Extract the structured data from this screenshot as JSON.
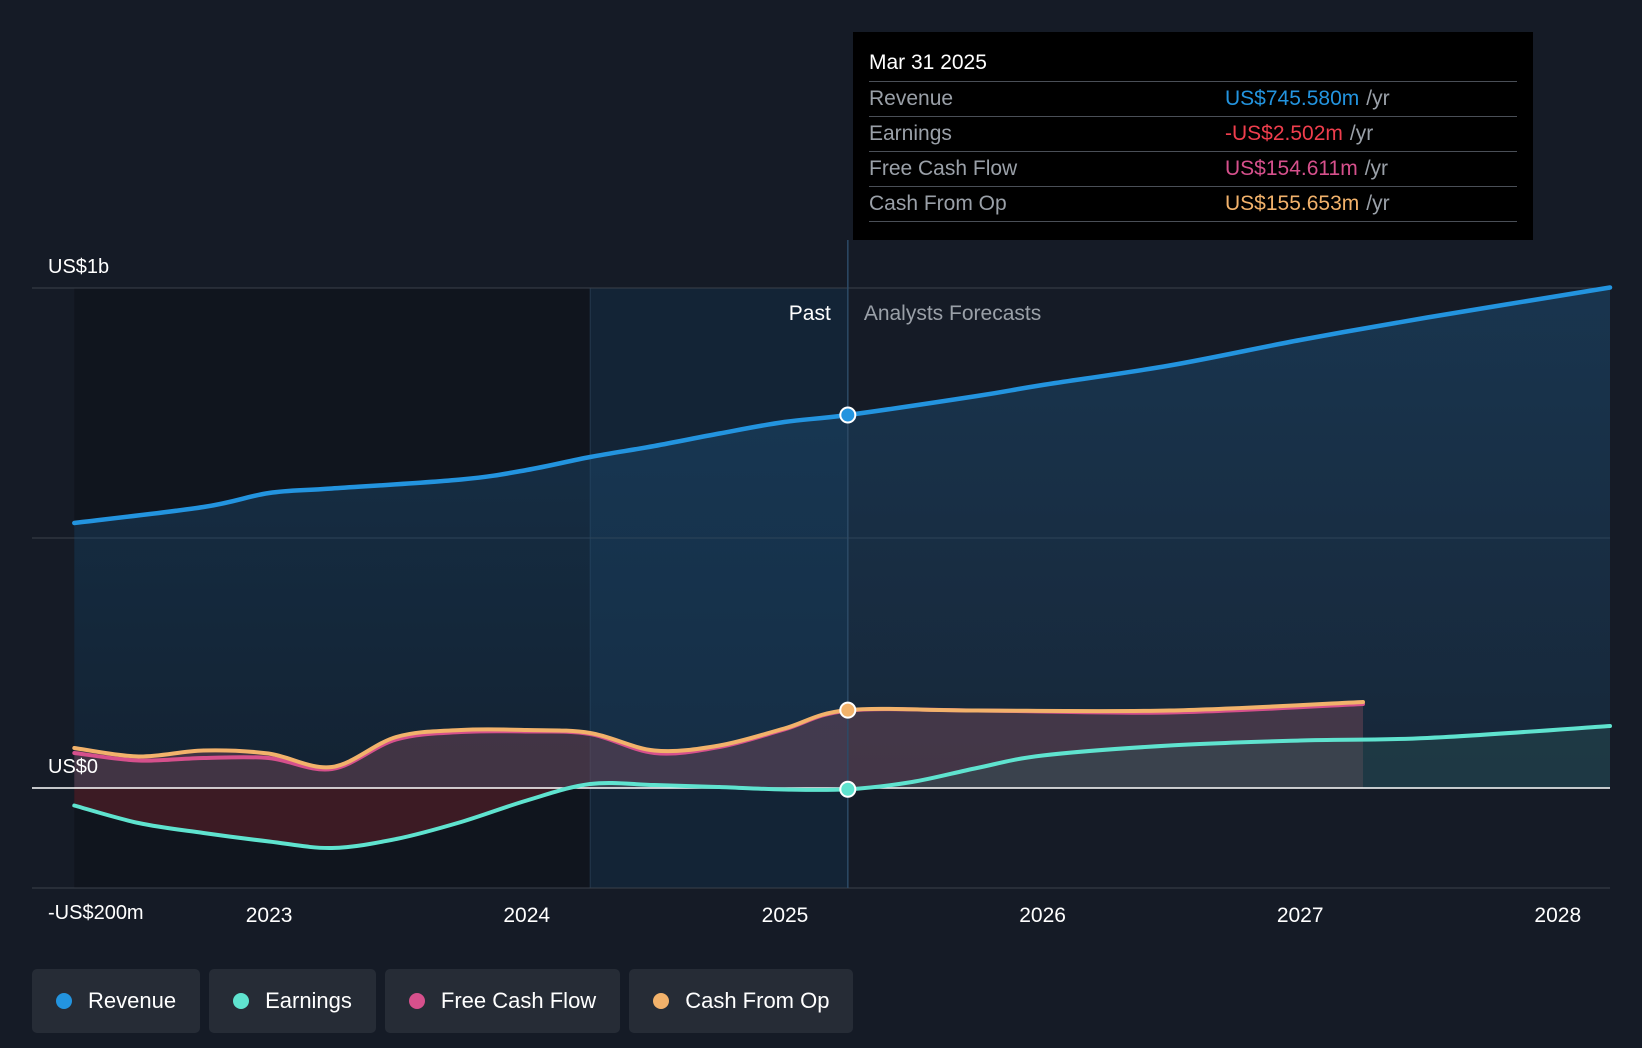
{
  "chart_data": {
    "type": "area",
    "title": "",
    "xlabel": "",
    "ylabel": "",
    "x_ticks": [
      "2023",
      "2024",
      "2025",
      "2026",
      "2027",
      "2028"
    ],
    "y_ticks": [
      {
        "value": 1000,
        "label": "US$1b"
      },
      {
        "value": 0,
        "label": "US$0"
      },
      {
        "value": -200,
        "label": "-US$200m"
      }
    ],
    "ylim": [
      -200,
      1000
    ],
    "xlim": [
      "2022-01-30",
      "2028-03-15"
    ],
    "grid": true,
    "legend_position": "bottom-left",
    "region_labels": {
      "past": "Past",
      "forecast": "Analysts Forecasts"
    },
    "highlight_start": "2024-03-31",
    "divider_date": "2025-03-31",
    "units": "US$ millions",
    "series": [
      {
        "name": "Revenue",
        "color": "#2394df",
        "points": [
          [
            "2022-03-31",
            530
          ],
          [
            "2022-09-30",
            562
          ],
          [
            "2023-01-01",
            590
          ],
          [
            "2023-03-31",
            599
          ],
          [
            "2023-09-30",
            617
          ],
          [
            "2024-01-01",
            636
          ],
          [
            "2024-03-31",
            662
          ],
          [
            "2024-06-30",
            684
          ],
          [
            "2024-09-30",
            709
          ],
          [
            "2024-12-31",
            732
          ],
          [
            "2025-03-31",
            746
          ],
          [
            "2025-09-30",
            784
          ],
          [
            "2026-01-01",
            806
          ],
          [
            "2026-06-30",
            845
          ],
          [
            "2027-01-01",
            896
          ],
          [
            "2027-06-30",
            941
          ],
          [
            "2028-03-15",
            1001
          ]
        ]
      },
      {
        "name": "Earnings",
        "color": "#5fe3cf",
        "points": [
          [
            "2022-03-31",
            -35
          ],
          [
            "2022-06-30",
            -70
          ],
          [
            "2022-09-30",
            -90
          ],
          [
            "2023-01-01",
            -107
          ],
          [
            "2023-03-31",
            -120
          ],
          [
            "2023-06-30",
            -102
          ],
          [
            "2023-09-30",
            -68
          ],
          [
            "2024-01-01",
            -25
          ],
          [
            "2024-03-31",
            8
          ],
          [
            "2024-06-30",
            6
          ],
          [
            "2024-09-30",
            2
          ],
          [
            "2024-12-31",
            -3
          ],
          [
            "2025-03-31",
            -2.5
          ],
          [
            "2025-06-30",
            12
          ],
          [
            "2025-09-30",
            40
          ],
          [
            "2026-01-01",
            65
          ],
          [
            "2026-06-30",
            85
          ],
          [
            "2027-01-01",
            95
          ],
          [
            "2027-06-30",
            100
          ],
          [
            "2028-03-15",
            124
          ]
        ]
      },
      {
        "name": "Free Cash Flow",
        "color": "#d6508c",
        "points": [
          [
            "2022-03-31",
            70
          ],
          [
            "2022-06-30",
            55
          ],
          [
            "2022-09-30",
            60
          ],
          [
            "2022-12-31",
            60
          ],
          [
            "2023-03-31",
            38
          ],
          [
            "2023-06-30",
            97
          ],
          [
            "2023-09-30",
            112
          ],
          [
            "2024-01-01",
            113
          ],
          [
            "2024-03-31",
            108
          ],
          [
            "2024-06-30",
            70
          ],
          [
            "2024-09-30",
            82
          ],
          [
            "2024-12-31",
            117
          ],
          [
            "2025-03-31",
            154.6
          ],
          [
            "2025-09-30",
            155
          ],
          [
            "2026-06-30",
            151
          ],
          [
            "2027-03-31",
            168
          ]
        ]
      },
      {
        "name": "Cash From Op",
        "color": "#f2b26b",
        "points": [
          [
            "2022-03-31",
            80
          ],
          [
            "2022-06-30",
            63
          ],
          [
            "2022-09-30",
            75
          ],
          [
            "2022-12-31",
            69
          ],
          [
            "2023-03-31",
            42
          ],
          [
            "2023-06-30",
            102
          ],
          [
            "2023-09-30",
            116
          ],
          [
            "2024-01-01",
            116
          ],
          [
            "2024-03-31",
            110
          ],
          [
            "2024-06-30",
            75
          ],
          [
            "2024-09-30",
            85
          ],
          [
            "2024-12-31",
            119
          ],
          [
            "2025-03-31",
            155.7
          ],
          [
            "2025-09-30",
            155
          ],
          [
            "2026-06-30",
            155
          ],
          [
            "2027-03-31",
            172
          ]
        ]
      }
    ]
  },
  "tooltip": {
    "date": "Mar 31 2025",
    "unit": "/yr",
    "rows": [
      {
        "label": "Revenue",
        "value": "US$745.580m",
        "color": "#2394df"
      },
      {
        "label": "Earnings",
        "value": "-US$2.502m",
        "color": "#ef3e4d"
      },
      {
        "label": "Free Cash Flow",
        "value": "US$154.611m",
        "color": "#d6508c"
      },
      {
        "label": "Cash From Op",
        "value": "US$155.653m",
        "color": "#f2b26b"
      }
    ]
  },
  "legend": [
    {
      "label": "Revenue",
      "color": "#2394df"
    },
    {
      "label": "Earnings",
      "color": "#5fe3cf"
    },
    {
      "label": "Free Cash Flow",
      "color": "#d6508c"
    },
    {
      "label": "Cash From Op",
      "color": "#f2b26b"
    }
  ]
}
